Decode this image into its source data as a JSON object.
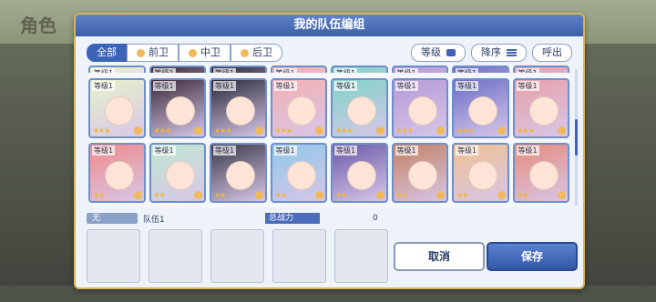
{
  "background": {
    "title": "角色"
  },
  "dialog": {
    "title": "我的队伍编组"
  },
  "filters": [
    {
      "label": "全部",
      "active": true
    },
    {
      "label": "前卫",
      "active": false
    },
    {
      "label": "中卫",
      "active": false
    },
    {
      "label": "后卫",
      "active": false
    }
  ],
  "controls": {
    "level": "等级",
    "sort": "降序",
    "call": "呼出"
  },
  "roster": {
    "level_label": "等级1",
    "rows": [
      [
        {
          "stars": "★★★"
        },
        {
          "stars": "★★★"
        },
        {
          "stars": "★★★"
        },
        {
          "stars": "★★★"
        },
        {
          "stars": "★★★"
        },
        {
          "stars": "★★★"
        },
        {
          "stars": "★★★"
        },
        {
          "stars": "★★★"
        }
      ],
      [
        {
          "stars": "★★"
        },
        {
          "stars": "★★"
        },
        {
          "stars": "★★"
        },
        {
          "stars": "★★"
        },
        {
          "stars": "★★"
        },
        {
          "stars": "★★"
        },
        {
          "stars": "★★"
        },
        {
          "stars": "★★"
        }
      ]
    ]
  },
  "team": {
    "tag": "无",
    "name": "队伍1",
    "power_label": "总战力",
    "power_value": "0"
  },
  "buttons": {
    "cancel": "取消",
    "save": "保存"
  }
}
